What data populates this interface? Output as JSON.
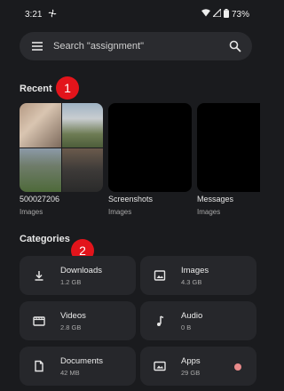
{
  "status": {
    "time": "3:21",
    "battery": "73%"
  },
  "search": {
    "placeholder": "Search \"assignment\""
  },
  "recent": {
    "title": "Recent",
    "badge": "1",
    "items": [
      {
        "name": "500027206",
        "subtitle": "Images"
      },
      {
        "name": "Screenshots",
        "subtitle": "Images"
      },
      {
        "name": "Messages",
        "subtitle": "Images"
      }
    ]
  },
  "categories": {
    "title": "Categories",
    "badge": "2",
    "items": [
      {
        "label": "Downloads",
        "size": "1.2 GB",
        "icon": "download-icon"
      },
      {
        "label": "Images",
        "size": "4.3 GB",
        "icon": "image-icon"
      },
      {
        "label": "Videos",
        "size": "2.8 GB",
        "icon": "video-icon"
      },
      {
        "label": "Audio",
        "size": "0 B",
        "icon": "music-note-icon"
      },
      {
        "label": "Documents",
        "size": "42 MB",
        "icon": "document-icon"
      },
      {
        "label": "Apps",
        "size": "29 GB",
        "icon": "apps-icon"
      }
    ]
  },
  "colors": {
    "background": "#1a1b1e",
    "tile": "#26272b",
    "badge": "#e3141b",
    "notification_dot": "#e88a8a"
  }
}
